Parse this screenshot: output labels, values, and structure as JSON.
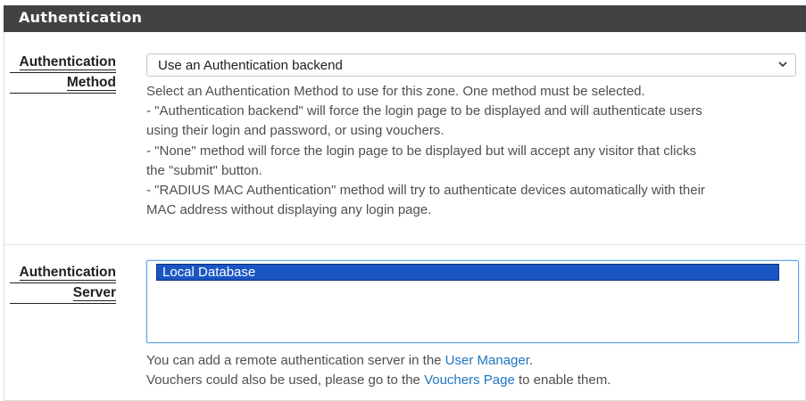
{
  "panel": {
    "title": "Authentication"
  },
  "method": {
    "label_line1": "Authentication",
    "label_line2": "Method",
    "selected": "Use an Authentication backend",
    "help": [
      "Select an Authentication Method to use for this zone. One method must be selected.",
      "- \"Authentication backend\" will force the login page to be displayed and will authenticate users",
      "using their login and password, or using vouchers.",
      "- \"None\" method will force the login page to be displayed but will accept any visitor that clicks",
      "the \"submit\" button.",
      "- \"RADIUS MAC Authentication\" method will try to authenticate devices automatically with their",
      "MAC address without displaying any login page."
    ]
  },
  "server": {
    "label_line1": "Authentication",
    "label_line2": "Server",
    "options": [
      "Local Database"
    ],
    "help_line1_prefix": "You can add a remote authentication server in the ",
    "user_manager_link": "User Manager",
    "help_line1_suffix": ".",
    "help_line2_prefix": "Vouchers could also be used, please go to the ",
    "vouchers_link": "Vouchers Page",
    "help_line2_suffix": " to enable them."
  },
  "icons": {
    "select_arrow": "chevron-down-icon"
  }
}
